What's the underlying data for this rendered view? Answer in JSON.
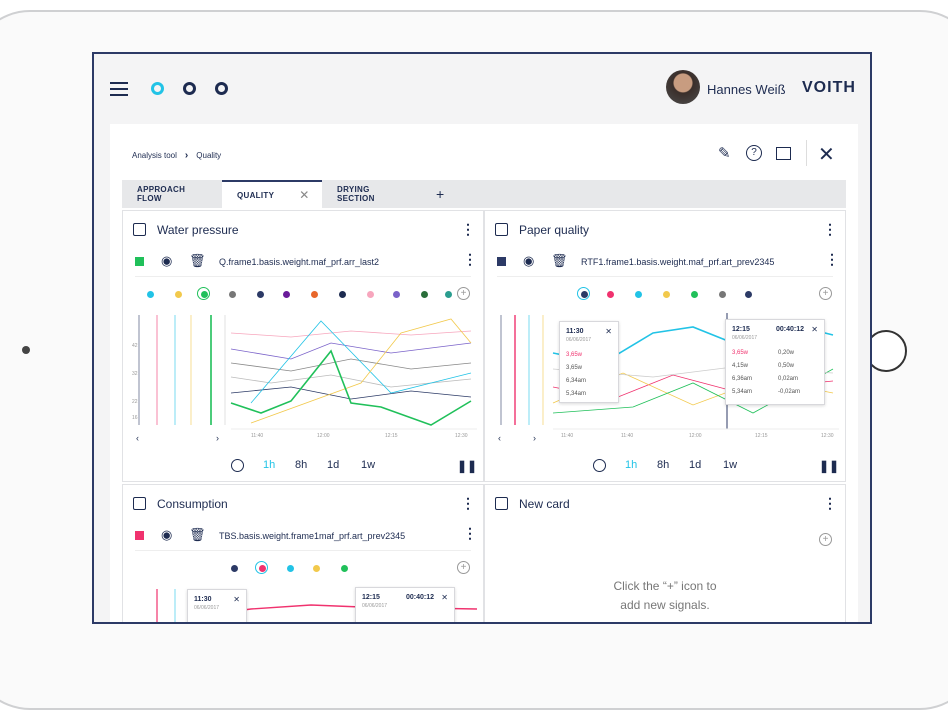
{
  "user": {
    "name": "Hannes Weiß"
  },
  "brand": "VOITH",
  "breadcrumb": {
    "root": "Analysis tool",
    "current": "Quality"
  },
  "tabs": [
    {
      "label": "APPROACH FLOW"
    },
    {
      "label": "QUALITY"
    },
    {
      "label": "DRYING SECTION"
    }
  ],
  "tab_add": "+",
  "cards": {
    "water": {
      "title": "Water pressure",
      "signal": "Q.frame1.basis.weight.maf_prf.arr_last2",
      "signal_color": "#20c05a",
      "yticks": [
        "42",
        "32",
        "22",
        "16"
      ],
      "xticks": [
        "11:40",
        "12:00",
        "12:15",
        "12:30"
      ],
      "nav_prev": "‹",
      "nav_next": "›"
    },
    "paper": {
      "title": "Paper quality",
      "signal": "RTF1.frame1.basis.weight.maf_prf.art_prev2345",
      "signal_color": "#2c3a66",
      "xticks": [
        "11:40",
        "12:00",
        "12:15",
        "12:30"
      ],
      "nav_prev": "‹",
      "nav_next": "›",
      "tip1": {
        "time": "11:30",
        "date": "06/06/2017",
        "rows": [
          "3,65w",
          "3,65w",
          "6,34am",
          "5,34am"
        ]
      },
      "tip2": {
        "time": "12:15",
        "duration": "00:40:12",
        "date": "06/06/2017",
        "rows": [
          [
            "3,65w",
            "0,20w"
          ],
          [
            "4,15w",
            "0,50w"
          ],
          [
            "6,36am",
            "0,02am"
          ],
          [
            "5,34am",
            "-0,02am"
          ]
        ]
      }
    },
    "consumption": {
      "title": "Consumption",
      "signal": "TBS.basis.weight.frame1maf_prf.art_prev2345",
      "signal_color": "#f0326e",
      "tip1": {
        "time": "11:30",
        "date": "06/06/2017"
      },
      "tip2": {
        "time": "12:15",
        "duration": "00:40:12",
        "date": "06/06/2017"
      }
    },
    "newcard": {
      "title": "New card",
      "hint_line1": "Click the “+” icon to",
      "hint_line2": "add new signals."
    }
  },
  "timebar": {
    "h1": "1h",
    "h8": "8h",
    "d1": "1d",
    "w1": "1w"
  },
  "icons": {
    "menu": "hamburger-icon",
    "edit": "pencil-icon",
    "help": "help-icon",
    "snapshot": "camera-icon",
    "close": "close-icon",
    "eye": "eye-icon",
    "trash": "trash-icon",
    "more": "kebab-icon",
    "add": "add-circle-icon",
    "clock": "clock-icon",
    "pause": "pause-icon"
  },
  "colors": {
    "navy": "#1d2b50",
    "cyan": "#22c3e6",
    "green": "#20c05a",
    "pink": "#f0326e",
    "yellow": "#f2c94c"
  }
}
